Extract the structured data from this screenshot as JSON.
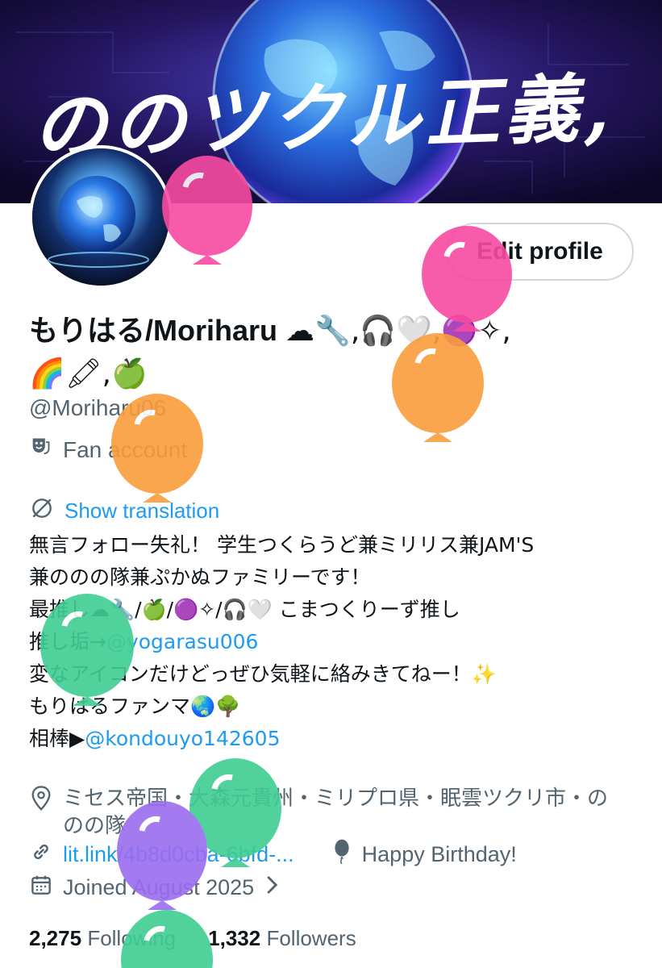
{
  "banner": {
    "text": "ののツクル正義,"
  },
  "header": {
    "edit_profile_label": "Edit profile"
  },
  "profile": {
    "display_name": "もりはる/Moriharu",
    "display_name_emoji_1": "☁🔧,🎧🤍,🟣✧,",
    "display_name_emoji_2": "🌈🖍,🍏",
    "handle": "@Moriharu06",
    "category": "Fan account"
  },
  "translation": {
    "label": "Show translation"
  },
  "bio": {
    "line1": "無言フォロー失礼！ 学生つくらうど兼ミリリス兼JAM'S",
    "line2": "兼ののの隊兼ぷかぬファミリーです！",
    "line3": "最推し☁🔧/🍏/🟣✧/🎧🤍 こまつくりーず推し",
    "line4_prefix": "推し垢→",
    "line4_link": "@yogarasu006",
    "line5": "変なアイコンだけどっぜひ気軽に絡みきてねー！✨",
    "line6": "もりはるファンマ🌏🌳",
    "line7_prefix": "相棒▶",
    "line7_link": "@kondouyo142605"
  },
  "meta": {
    "location": "ミセス帝国・大森元貴州・ミリプロ県・眠雲ツクリ市・ののの隊",
    "website": "lit.link/4b8d0cba-6bfd-...",
    "birthday": "Happy Birthday!",
    "joined": "Joined August 2025"
  },
  "stats": {
    "following_count": "2,275",
    "following_label": "Following",
    "followers_count": "1,332",
    "followers_label": "Followers"
  },
  "colors": {
    "link": "#1d9bf0",
    "secondary_text": "#536471",
    "balloon_pink": "#f84aa1",
    "balloon_orange": "#f99d3c",
    "balloon_green": "#3fce93",
    "balloon_purple": "#9b6cf0"
  }
}
